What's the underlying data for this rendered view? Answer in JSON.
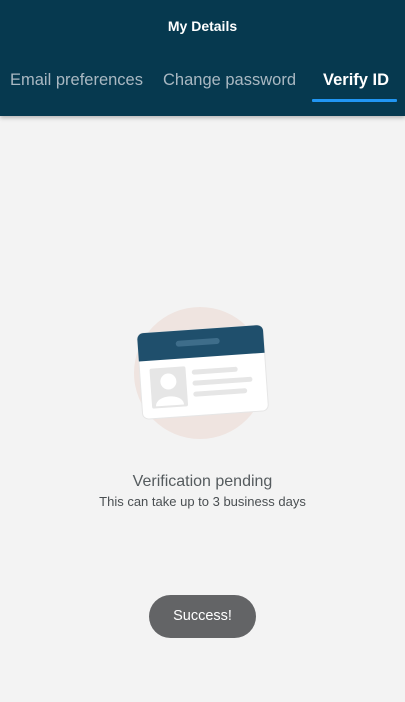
{
  "header": {
    "title": "My Details"
  },
  "tabs": [
    {
      "label": "Email preferences",
      "active": false
    },
    {
      "label": "Change password",
      "active": false
    },
    {
      "label": "Verify ID",
      "active": true
    }
  ],
  "illustration": {
    "icon": "id-card-icon"
  },
  "status": {
    "title": "Verification pending",
    "subtitle": "This can take up to 3 business days"
  },
  "toast": {
    "message": "Success!"
  },
  "colors": {
    "header_bg": "#06394f",
    "tab_indicator": "#2196f3",
    "background": "#f3f3f3",
    "toast_bg": "#636466"
  }
}
